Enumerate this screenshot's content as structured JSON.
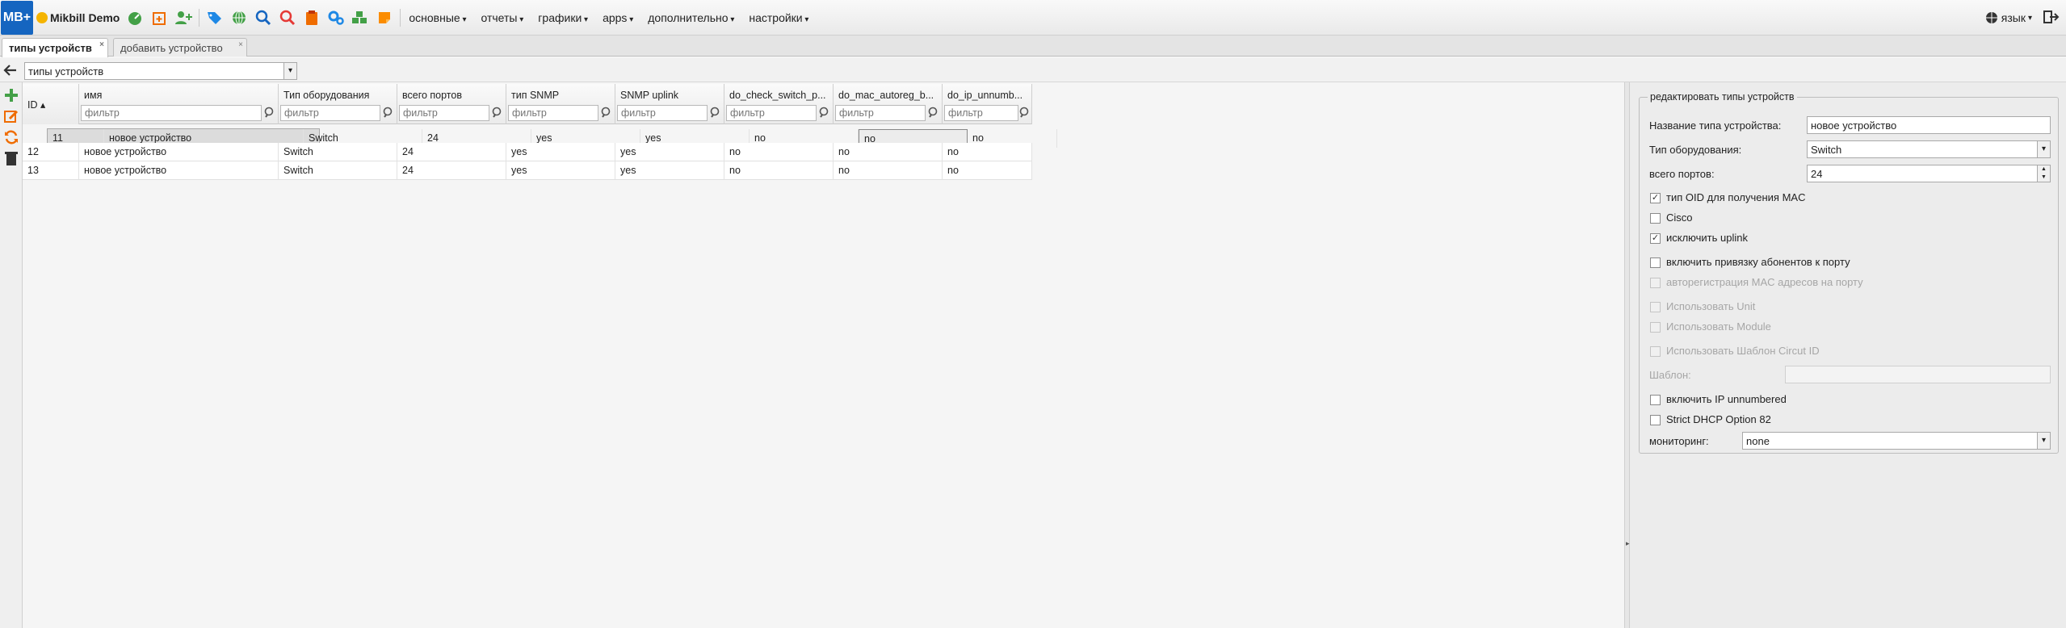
{
  "app": {
    "logo": "MB+",
    "brand": "Mikbill Demo",
    "menu": [
      "основные",
      "отчеты",
      "графики",
      "apps",
      "дополнительно",
      "настройки"
    ],
    "lang": "язык"
  },
  "tabs": [
    {
      "label": "типы устройств",
      "close": "×"
    },
    {
      "label": "добавить устройство",
      "close": "×"
    }
  ],
  "toolbar": {
    "selector_value": "типы устройств",
    "arrow": "▾"
  },
  "grid": {
    "columns": [
      "ID ▴",
      "имя",
      "Тип оборудования",
      "всего портов",
      "тип SNMP",
      "SNMP uplink",
      "do_check_switch_p...",
      "do_mac_autoreg_b...",
      "do_ip_unnumb..."
    ],
    "filter_placeholder": "фильтр",
    "rows": [
      [
        "11",
        "новое устройство",
        "Switch",
        "24",
        "yes",
        "yes",
        "no",
        "no",
        "no"
      ],
      [
        "12",
        "новое устройство",
        "Switch",
        "24",
        "yes",
        "yes",
        "no",
        "no",
        "no"
      ],
      [
        "13",
        "новое устройство",
        "Switch",
        "24",
        "yes",
        "yes",
        "no",
        "no",
        "no"
      ]
    ]
  },
  "form": {
    "legend": "редактировать типы устройств",
    "name_label": "Название типа устройства:",
    "name_value": "новое устройство",
    "hwtype_label": "Тип оборудования:",
    "hwtype_value": "Switch",
    "ports_label": "всего портов:",
    "ports_value": "24",
    "checkboxes": [
      {
        "label": "тип OID для получения MAC",
        "checked": "✓"
      },
      {
        "label": "Cisco",
        "checked": ""
      },
      {
        "label": "исключить uplink",
        "checked": "✓"
      },
      {
        "label": "включить привязку абонентов к порту",
        "checked": ""
      },
      {
        "label": "авторегистрация MAC адресов на порту",
        "checked": ""
      },
      {
        "label": "Использовать Unit",
        "checked": ""
      },
      {
        "label": "Использовать Module",
        "checked": ""
      },
      {
        "label": "Использовать Шаблон Circut ID",
        "checked": ""
      },
      {
        "label": "включить IP unnumbered",
        "checked": ""
      },
      {
        "label": "Strict DHCP Option 82",
        "checked": ""
      }
    ],
    "template_label": "Шаблон:",
    "monitoring_label": "мониторинг:",
    "monitoring_value": "none"
  },
  "colors": {
    "logo_bg": "#1565c0",
    "accent_green": "#43a047",
    "accent_orange": "#ef6c00",
    "accent_blue": "#1e88e5"
  }
}
